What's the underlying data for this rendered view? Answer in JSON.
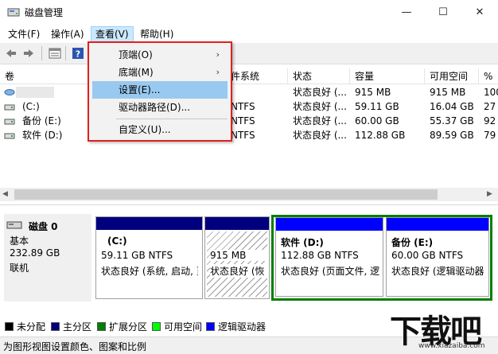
{
  "window": {
    "title": "磁盘管理",
    "min": "—",
    "max": "☐",
    "close": "✕"
  },
  "menubar": [
    "文件(F)",
    "操作(A)",
    "查看(V)",
    "帮助(H)"
  ],
  "view_menu": {
    "items": [
      {
        "label": "顶端(O)",
        "submenu": true
      },
      {
        "label": "底端(M)",
        "submenu": true
      },
      {
        "label": "设置(E)...",
        "submenu": false,
        "highlighted": true
      },
      {
        "label": "驱动器路径(D)...",
        "submenu": false
      },
      {
        "label": "自定义(U)...",
        "submenu": false
      }
    ]
  },
  "table": {
    "columns": [
      "卷",
      "件系统",
      "状态",
      "容量",
      "可用空间",
      "%"
    ],
    "rows": [
      {
        "volume": "",
        "fs": "",
        "status": "状态良好 (...",
        "capacity": "915 MB",
        "free": "915 MB",
        "pct": "100"
      },
      {
        "volume": "(C:)",
        "fs": "NTFS",
        "status": "状态良好 (...",
        "capacity": "59.11 GB",
        "free": "16.04 GB",
        "pct": "27"
      },
      {
        "volume": "备份 (E:)",
        "fs": "NTFS",
        "status": "状态良好 (...",
        "capacity": "60.00 GB",
        "free": "55.37 GB",
        "pct": "92"
      },
      {
        "volume": "软件 (D:)",
        "fs": "NTFS",
        "status": "状态良好 (...",
        "capacity": "112.88 GB",
        "free": "89.59 GB",
        "pct": "79"
      }
    ]
  },
  "disk": {
    "name": "磁盘 0",
    "type": "基本",
    "size": "232.89 GB",
    "status": "联机"
  },
  "partitions": [
    {
      "name": "(C:)",
      "size": "59.11 GB NTFS",
      "status": "状态良好 (系统, 启动, 页"
    },
    {
      "name": "",
      "size": "915 MB",
      "status": "状态良好 (恢"
    },
    {
      "name": "软件  (D:)",
      "size": "112.88 GB NTFS",
      "status": "状态良好 (页面文件, 逻"
    },
    {
      "name": "备份  (E:)",
      "size": "60.00 GB NTFS",
      "status": "状态良好 (逻辑驱动器"
    }
  ],
  "legend": [
    {
      "label": "未分配",
      "color": "#000000"
    },
    {
      "label": "主分区",
      "color": "#00007f"
    },
    {
      "label": "扩展分区",
      "color": "#007f00"
    },
    {
      "label": "可用空间",
      "color": "#00ff00"
    },
    {
      "label": "逻辑驱动器",
      "color": "#0000ff"
    }
  ],
  "statusbar": {
    "text": "为图形视图设置颜色、图案和比例"
  },
  "watermark": {
    "main": "下载吧",
    "sub": "www.xiazaiba.com"
  },
  "colors": {
    "primary": "#00007f",
    "logical": "#0000ff",
    "extended": "#007f00",
    "selection": "#99c9ef",
    "highlight_border": "#e0201e"
  }
}
